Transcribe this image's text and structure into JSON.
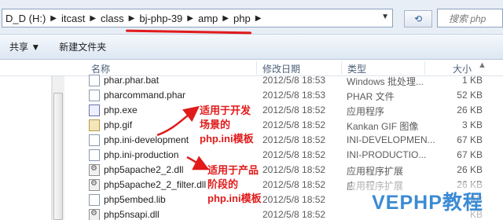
{
  "address": {
    "crumbs": [
      "D_D (H:)",
      "itcast",
      "class",
      "bj-php-39",
      "amp",
      "php"
    ],
    "search_placeholder": "搜索 php"
  },
  "toolbar": {
    "share_label": "共享 ▼",
    "new_folder_label": "新建文件夹"
  },
  "columns": {
    "name": "名称",
    "modified": "修改日期",
    "type": "类型",
    "size": "大小"
  },
  "files": [
    {
      "name": "phar.phar.bat",
      "date": "2012/5/8 18:53",
      "type": "Windows 批处理...",
      "size": "1 KB",
      "icon": "file-icon"
    },
    {
      "name": "pharcommand.phar",
      "date": "2012/5/8 18:53",
      "type": "PHAR 文件",
      "size": "52 KB",
      "icon": "file-icon"
    },
    {
      "name": "php.exe",
      "date": "2012/5/8 18:52",
      "type": "应用程序",
      "size": "26 KB",
      "icon": "php-exe-icon"
    },
    {
      "name": "php.gif",
      "date": "2012/5/8 18:52",
      "type": "Kankan GIF 图像",
      "size": "3 KB",
      "icon": "gif-icon"
    },
    {
      "name": "php.ini-development",
      "date": "2012/5/8 18:52",
      "type": "INI-DEVELOPMEN...",
      "size": "67 KB",
      "icon": "file-icon"
    },
    {
      "name": "php.ini-production",
      "date": "2012/5/8 18:52",
      "type": "INI-PRODUCTIO...",
      "size": "67 KB",
      "icon": "file-icon"
    },
    {
      "name": "php5apache2_2.dll",
      "date": "2012/5/8 18:52",
      "type": "应用程序扩展",
      "size": "26 KB",
      "icon": "dll-icon"
    },
    {
      "name": "php5apache2_2_filter.dll",
      "date": "2012/5/8 18:52",
      "type": "应用程序扩展",
      "size": "26 KB",
      "icon": "dll-icon"
    },
    {
      "name": "php5embed.lib",
      "date": "2012/5/8 18:52",
      "type": "",
      "size": "KB",
      "icon": "file-icon"
    },
    {
      "name": "php5nsapi.dll",
      "date": "2012/5/8 18:52",
      "type": "",
      "size": "KB",
      "icon": "dll-icon"
    }
  ],
  "annotations": {
    "dev_note_line1": "适用于开发",
    "dev_note_line2": "场景的",
    "dev_note_line3": "php.ini模板",
    "prod_note_line1": "适用于产品",
    "prod_note_line2": "阶段的",
    "prod_note_line3": "php.ini模板",
    "color": "#e11a1a"
  },
  "watermark": "VEPHP教程"
}
